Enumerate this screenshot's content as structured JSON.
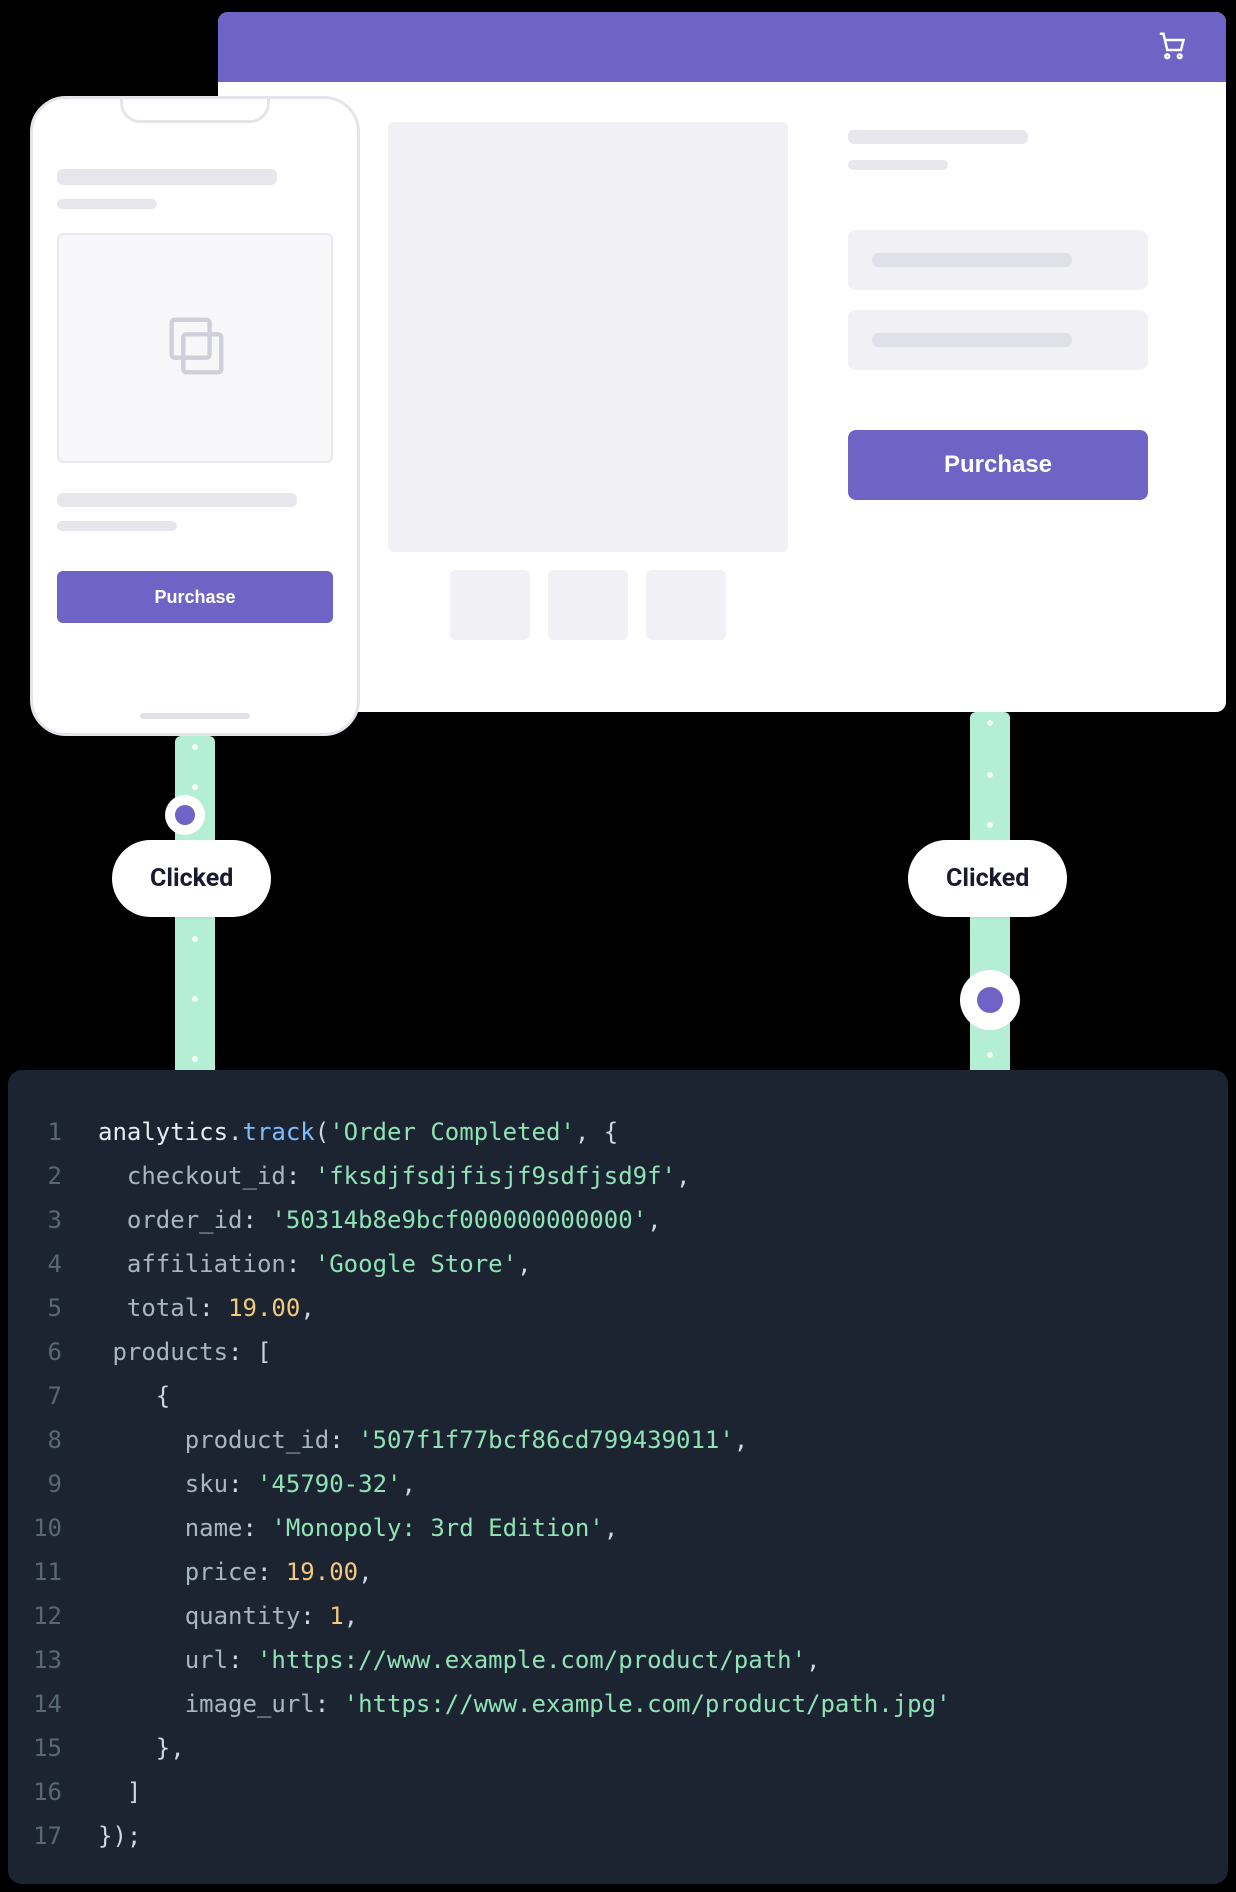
{
  "desktop": {
    "purchase_label": "Purchase"
  },
  "mobile": {
    "purchase_label": "Purchase"
  },
  "events": {
    "left_label": "Clicked",
    "right_label": "Clicked"
  },
  "code": {
    "object": "analytics",
    "method": "track",
    "event_name": "Order Completed",
    "fields": {
      "checkout_id": "fksdjfsdjfisjf9sdfjsd9f",
      "order_id": "50314b8e9bcf000000000000",
      "affiliation": "Google Store",
      "total": "19.00"
    },
    "products_key": "products",
    "product": {
      "product_id": "507f1f77bcf86cd799439011",
      "sku": "45790-32",
      "name": "Monopoly: 3rd Edition",
      "price": "19.00",
      "quantity": "1",
      "url": "https://www.example.com/product/path",
      "image_url": "https://www.example.com/product/path.jpg"
    },
    "line_numbers": [
      "1",
      "2",
      "3",
      "4",
      "5",
      "6",
      "7",
      "8",
      "9",
      "10",
      "11",
      "12",
      "13",
      "14",
      "15",
      "16",
      "17"
    ]
  }
}
